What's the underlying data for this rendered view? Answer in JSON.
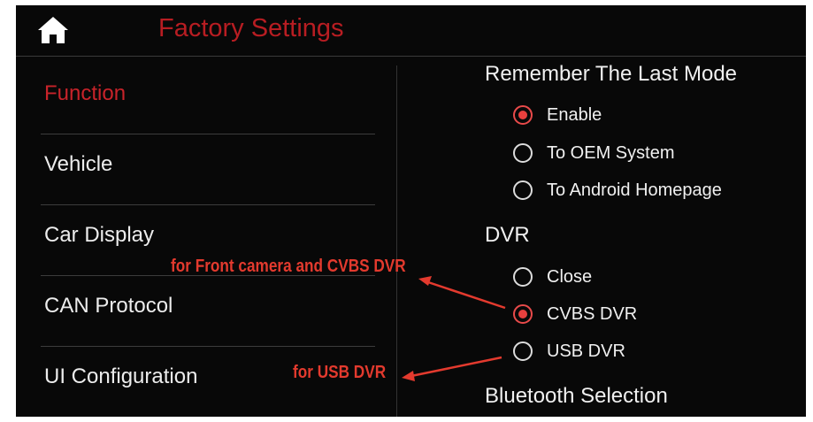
{
  "header": {
    "title": "Factory Settings",
    "home_icon": "home-icon"
  },
  "sidebar": {
    "items": [
      {
        "label": "Function",
        "active": true
      },
      {
        "label": "Vehicle",
        "active": false
      },
      {
        "label": "Car Display",
        "active": false
      },
      {
        "label": "CAN Protocol",
        "active": false
      },
      {
        "label": "UI Configuration",
        "active": false
      }
    ]
  },
  "settings": {
    "remember_last_mode": {
      "title": "Remember The Last Mode",
      "options": [
        {
          "label": "Enable",
          "checked": true
        },
        {
          "label": "To OEM System",
          "checked": false
        },
        {
          "label": "To Android Homepage",
          "checked": false
        }
      ]
    },
    "dvr": {
      "title": "DVR",
      "options": [
        {
          "label": "Close",
          "checked": false
        },
        {
          "label": "CVBS DVR",
          "checked": true
        },
        {
          "label": "USB DVR",
          "checked": false
        }
      ]
    },
    "bluetooth": {
      "title": "Bluetooth Selection"
    }
  },
  "annotations": {
    "front_camera": "for Front camera and CVBS DVR",
    "usb_dvr": "for USB DVR"
  },
  "colors": {
    "accent": "#c8232a",
    "annotation": "#e33a2e",
    "background": "#080808",
    "text": "#f0f0f0"
  }
}
